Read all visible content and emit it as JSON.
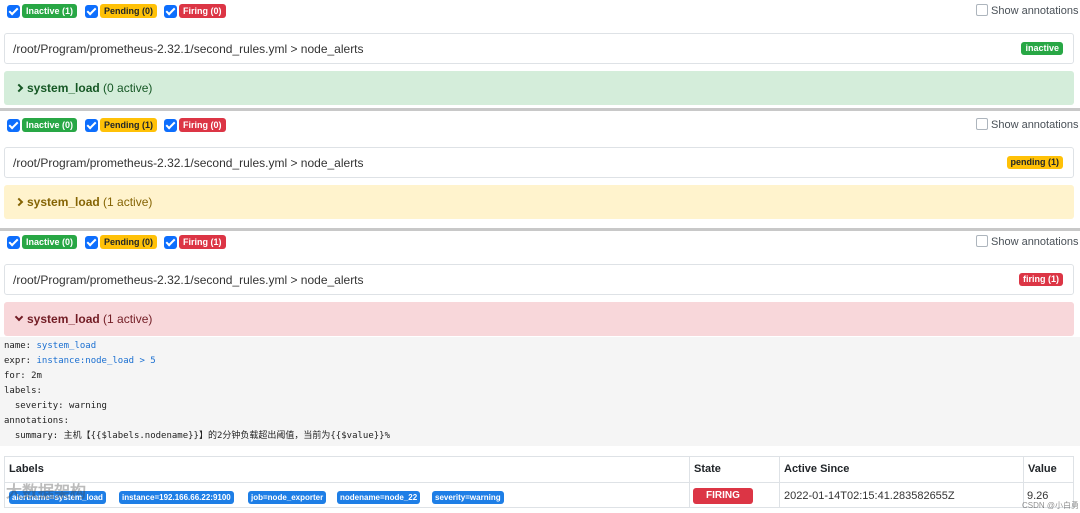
{
  "panels": [
    {
      "filters": {
        "inactive": "Inactive (1)",
        "pending": "Pending (0)",
        "firing": "Firing (0)"
      },
      "show_annotations": "Show annotations",
      "rule_file": "/root/Program/prometheus-2.32.1/second_rules.yml > node_alerts",
      "file_state": "inactive",
      "group_name": "system_load",
      "group_active": "(0 active)"
    },
    {
      "filters": {
        "inactive": "Inactive (0)",
        "pending": "Pending (1)",
        "firing": "Firing (0)"
      },
      "show_annotations": "Show annotations",
      "rule_file": "/root/Program/prometheus-2.32.1/second_rules.yml > node_alerts",
      "file_state": "pending (1)",
      "group_name": "system_load",
      "group_active": "(1 active)"
    },
    {
      "filters": {
        "inactive": "Inactive (0)",
        "pending": "Pending (0)",
        "firing": "Firing (1)"
      },
      "show_annotations": "Show annotations",
      "rule_file": "/root/Program/prometheus-2.32.1/second_rules.yml > node_alerts",
      "file_state": "firing (1)",
      "group_name": "system_load",
      "group_active": "(1 active)"
    }
  ],
  "rule": {
    "name_key": "name:",
    "name_val": "system_load",
    "expr_key": "expr:",
    "expr_val": "instance:node_load > 5",
    "for_line": "for: 2m",
    "labels_line": "labels:",
    "severity_line": "  severity: warning",
    "annotations_line": "annotations:",
    "summary_line": "  summary: 主机【{{$labels.nodename}}】的2分钟负载超出阈值，当前为{{$value}}%"
  },
  "table": {
    "headers": {
      "labels": "Labels",
      "state": "State",
      "active_since": "Active Since",
      "value": "Value"
    },
    "row": {
      "labels": [
        "alertname=system_load",
        "instance=192.166.66.22:9100",
        "job=node_exporter",
        "nodename=node_22",
        "severity=warning"
      ],
      "state": "FIRING",
      "active_since": "2022-01-14T02:15:41.283582655Z",
      "value": "9.26"
    }
  },
  "watermark": "大数据架构",
  "watermark_small": "CSDN @小白勇"
}
